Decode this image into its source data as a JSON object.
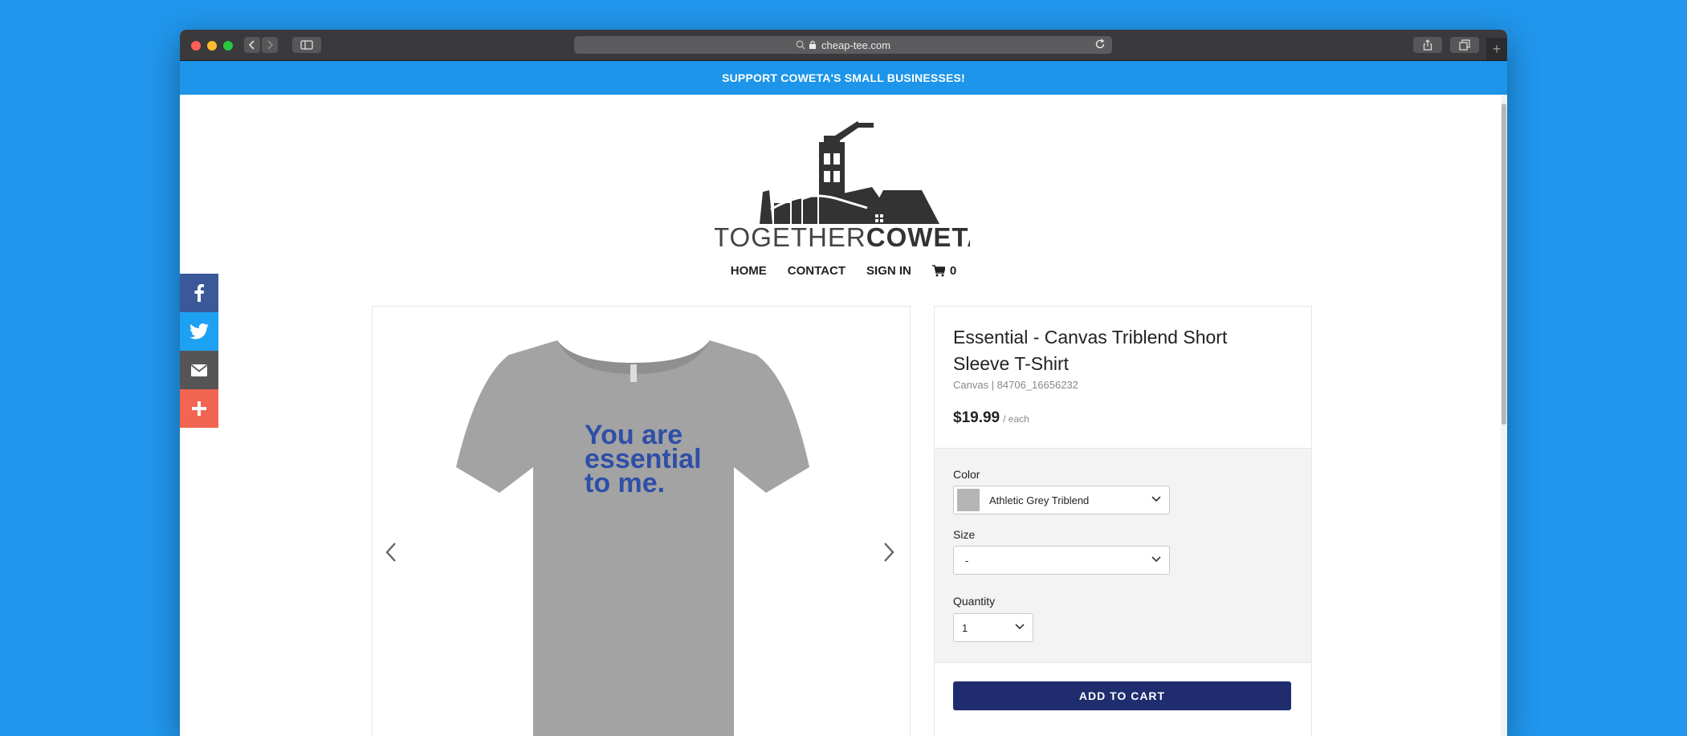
{
  "browser": {
    "url": "cheap-tee.com"
  },
  "banner": {
    "text": "SUPPORT COWETA'S SMALL BUSINESSES!"
  },
  "logo": {
    "word_light": "TOGETHER",
    "word_bold": "COWETA"
  },
  "nav": {
    "home": "HOME",
    "contact": "CONTACT",
    "sign_in": "SIGN IN",
    "cart_count": "0"
  },
  "social": {
    "facebook_color": "#3b5998",
    "twitter_color": "#1da1f2",
    "email_color": "#555555",
    "share_color": "#f26552"
  },
  "product": {
    "title": "Essential - Canvas Triblend Short Sleeve T-Shirt",
    "sku": "Canvas | 84706_16656232",
    "price": "$19.99",
    "price_unit": "/ each",
    "shirt_text_line1": "You are",
    "shirt_text_line2": "essential",
    "shirt_text_line3": "to me.",
    "shirt_color": "#a3a3a3",
    "shirt_text_color": "#2e4fa8"
  },
  "options": {
    "color_label": "Color",
    "color_value": "Athletic Grey Triblend",
    "size_label": "Size",
    "size_value": "-",
    "quantity_label": "Quantity",
    "quantity_value": "1"
  },
  "actions": {
    "add_to_cart": "ADD TO CART",
    "button_color": "#1f2d6e"
  }
}
